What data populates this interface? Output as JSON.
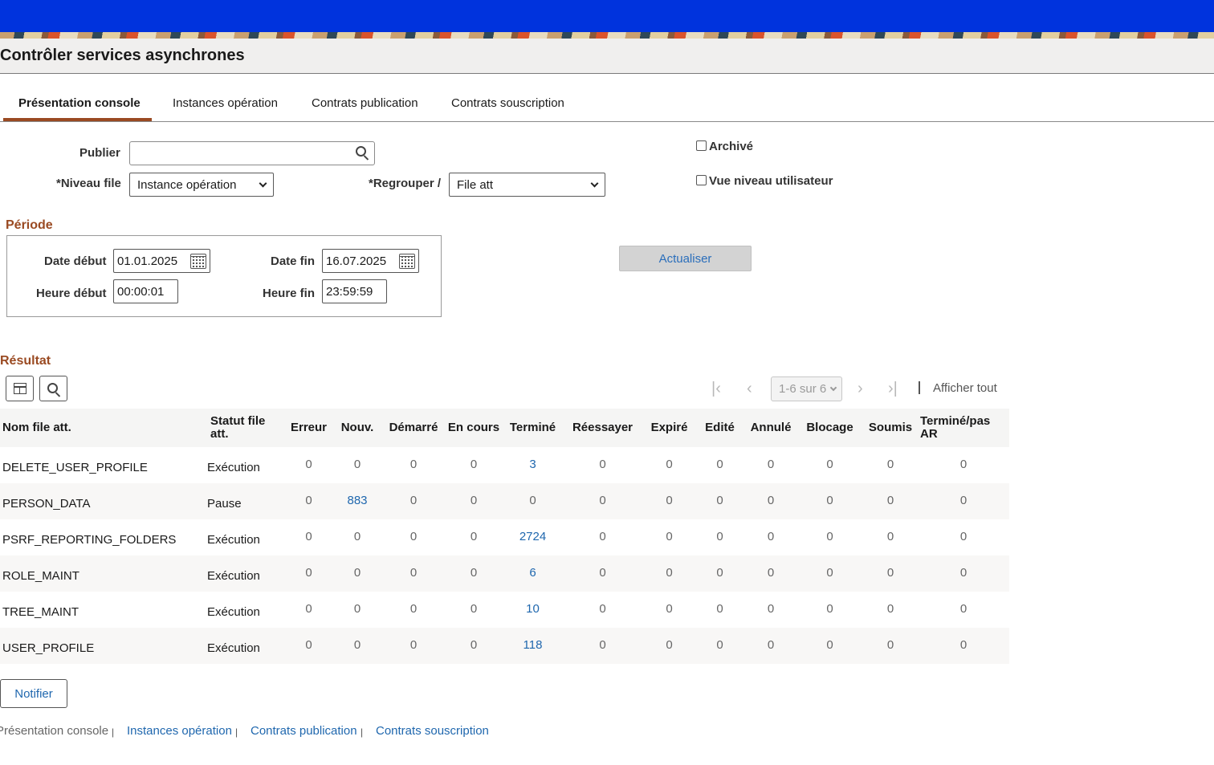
{
  "page": {
    "title": "Contrôler services asynchrones"
  },
  "tabs": [
    "Présentation console",
    "Instances opération",
    "Contrats publication",
    "Contrats souscription"
  ],
  "colors": {
    "header_blue": "#0033dd",
    "accent": "#9a4a22",
    "link": "#1f67ae"
  },
  "form": {
    "publier_label": "Publier",
    "publier_value": "",
    "niveau_label": "*Niveau file",
    "niveau_value": "Instance opération",
    "regrouper_label": "*Regrouper /",
    "regrouper_value": "File att",
    "archive_label": "Archivé",
    "vue_label": "Vue niveau utilisateur"
  },
  "periode": {
    "title": "Période",
    "date_debut_label": "Date début",
    "date_debut": "01.01.2025",
    "date_fin_label": "Date fin",
    "date_fin": "16.07.2025",
    "heure_debut_label": "Heure début",
    "heure_debut": "00:00:01",
    "heure_fin_label": "Heure fin",
    "heure_fin": "23:59:59"
  },
  "actualiser_label": "Actualiser",
  "result": {
    "title": "Résultat",
    "pager_text": "1-6 sur 6",
    "show_all": "Afficher tout",
    "columns": [
      "Nom file att.",
      "Statut file att.",
      "Erreur",
      "Nouv.",
      "Démarré",
      "En cours",
      "Terminé",
      "Réessayer",
      "Expiré",
      "Edité",
      "Annulé",
      "Blocage",
      "Soumis",
      "Terminé/pas AR"
    ],
    "rows": [
      [
        "DELETE_USER_PROFILE",
        "Exécution",
        "0",
        "0",
        "0",
        "0",
        "3",
        "0",
        "0",
        "0",
        "0",
        "0",
        "0",
        "0"
      ],
      [
        "PERSON_DATA",
        "Pause",
        "0",
        "883",
        "0",
        "0",
        "0",
        "0",
        "0",
        "0",
        "0",
        "0",
        "0",
        "0"
      ],
      [
        "PSRF_REPORTING_FOLDERS",
        "Exécution",
        "0",
        "0",
        "0",
        "0",
        "2724",
        "0",
        "0",
        "0",
        "0",
        "0",
        "0",
        "0"
      ],
      [
        "ROLE_MAINT",
        "Exécution",
        "0",
        "0",
        "0",
        "0",
        "6",
        "0",
        "0",
        "0",
        "0",
        "0",
        "0",
        "0"
      ],
      [
        "TREE_MAINT",
        "Exécution",
        "0",
        "0",
        "0",
        "0",
        "10",
        "0",
        "0",
        "0",
        "0",
        "0",
        "0",
        "0"
      ],
      [
        "USER_PROFILE",
        "Exécution",
        "0",
        "0",
        "0",
        "0",
        "118",
        "0",
        "0",
        "0",
        "0",
        "0",
        "0",
        "0"
      ]
    ]
  },
  "notifier_label": "Notifier",
  "footer": [
    "Présentation console",
    "Instances opération",
    "Contrats publication",
    "Contrats souscription"
  ]
}
